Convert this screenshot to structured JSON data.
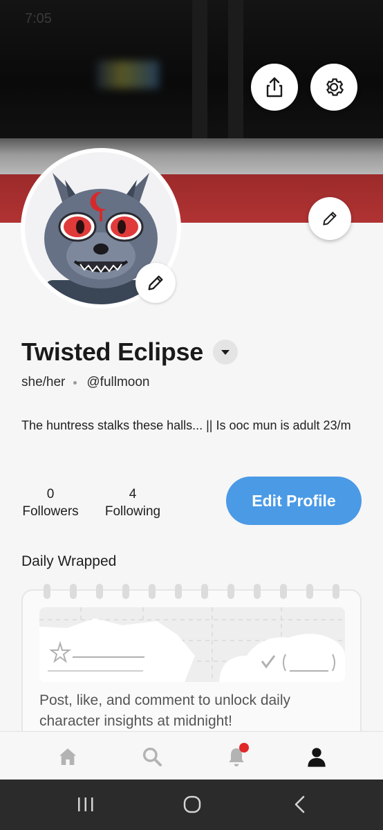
{
  "status": {
    "time": "7:05"
  },
  "profile": {
    "name": "Twisted Eclipse",
    "pronouns": "she/her",
    "handle": "@fullmoon",
    "bio": "The huntress stalks these halls... || Is ooc mun is adult 23/m"
  },
  "stats": {
    "followers_count": "0",
    "followers_label": "Followers",
    "following_count": "4",
    "following_label": "Following"
  },
  "actions": {
    "edit_profile_label": "Edit Profile"
  },
  "daily_wrapped": {
    "title": "Daily Wrapped",
    "message": "Post, like, and comment to unlock daily character insights at midnight!"
  },
  "icons": {
    "share": "share-icon",
    "settings": "gear-icon",
    "edit": "pencil-icon",
    "dropdown": "caret-down-icon",
    "home": "home-icon",
    "search": "search-icon",
    "notifications": "bell-icon",
    "profile": "person-icon"
  },
  "colors": {
    "accent": "#4a9ae6",
    "notification_badge": "#e02828",
    "banner_red": "#b13333"
  }
}
